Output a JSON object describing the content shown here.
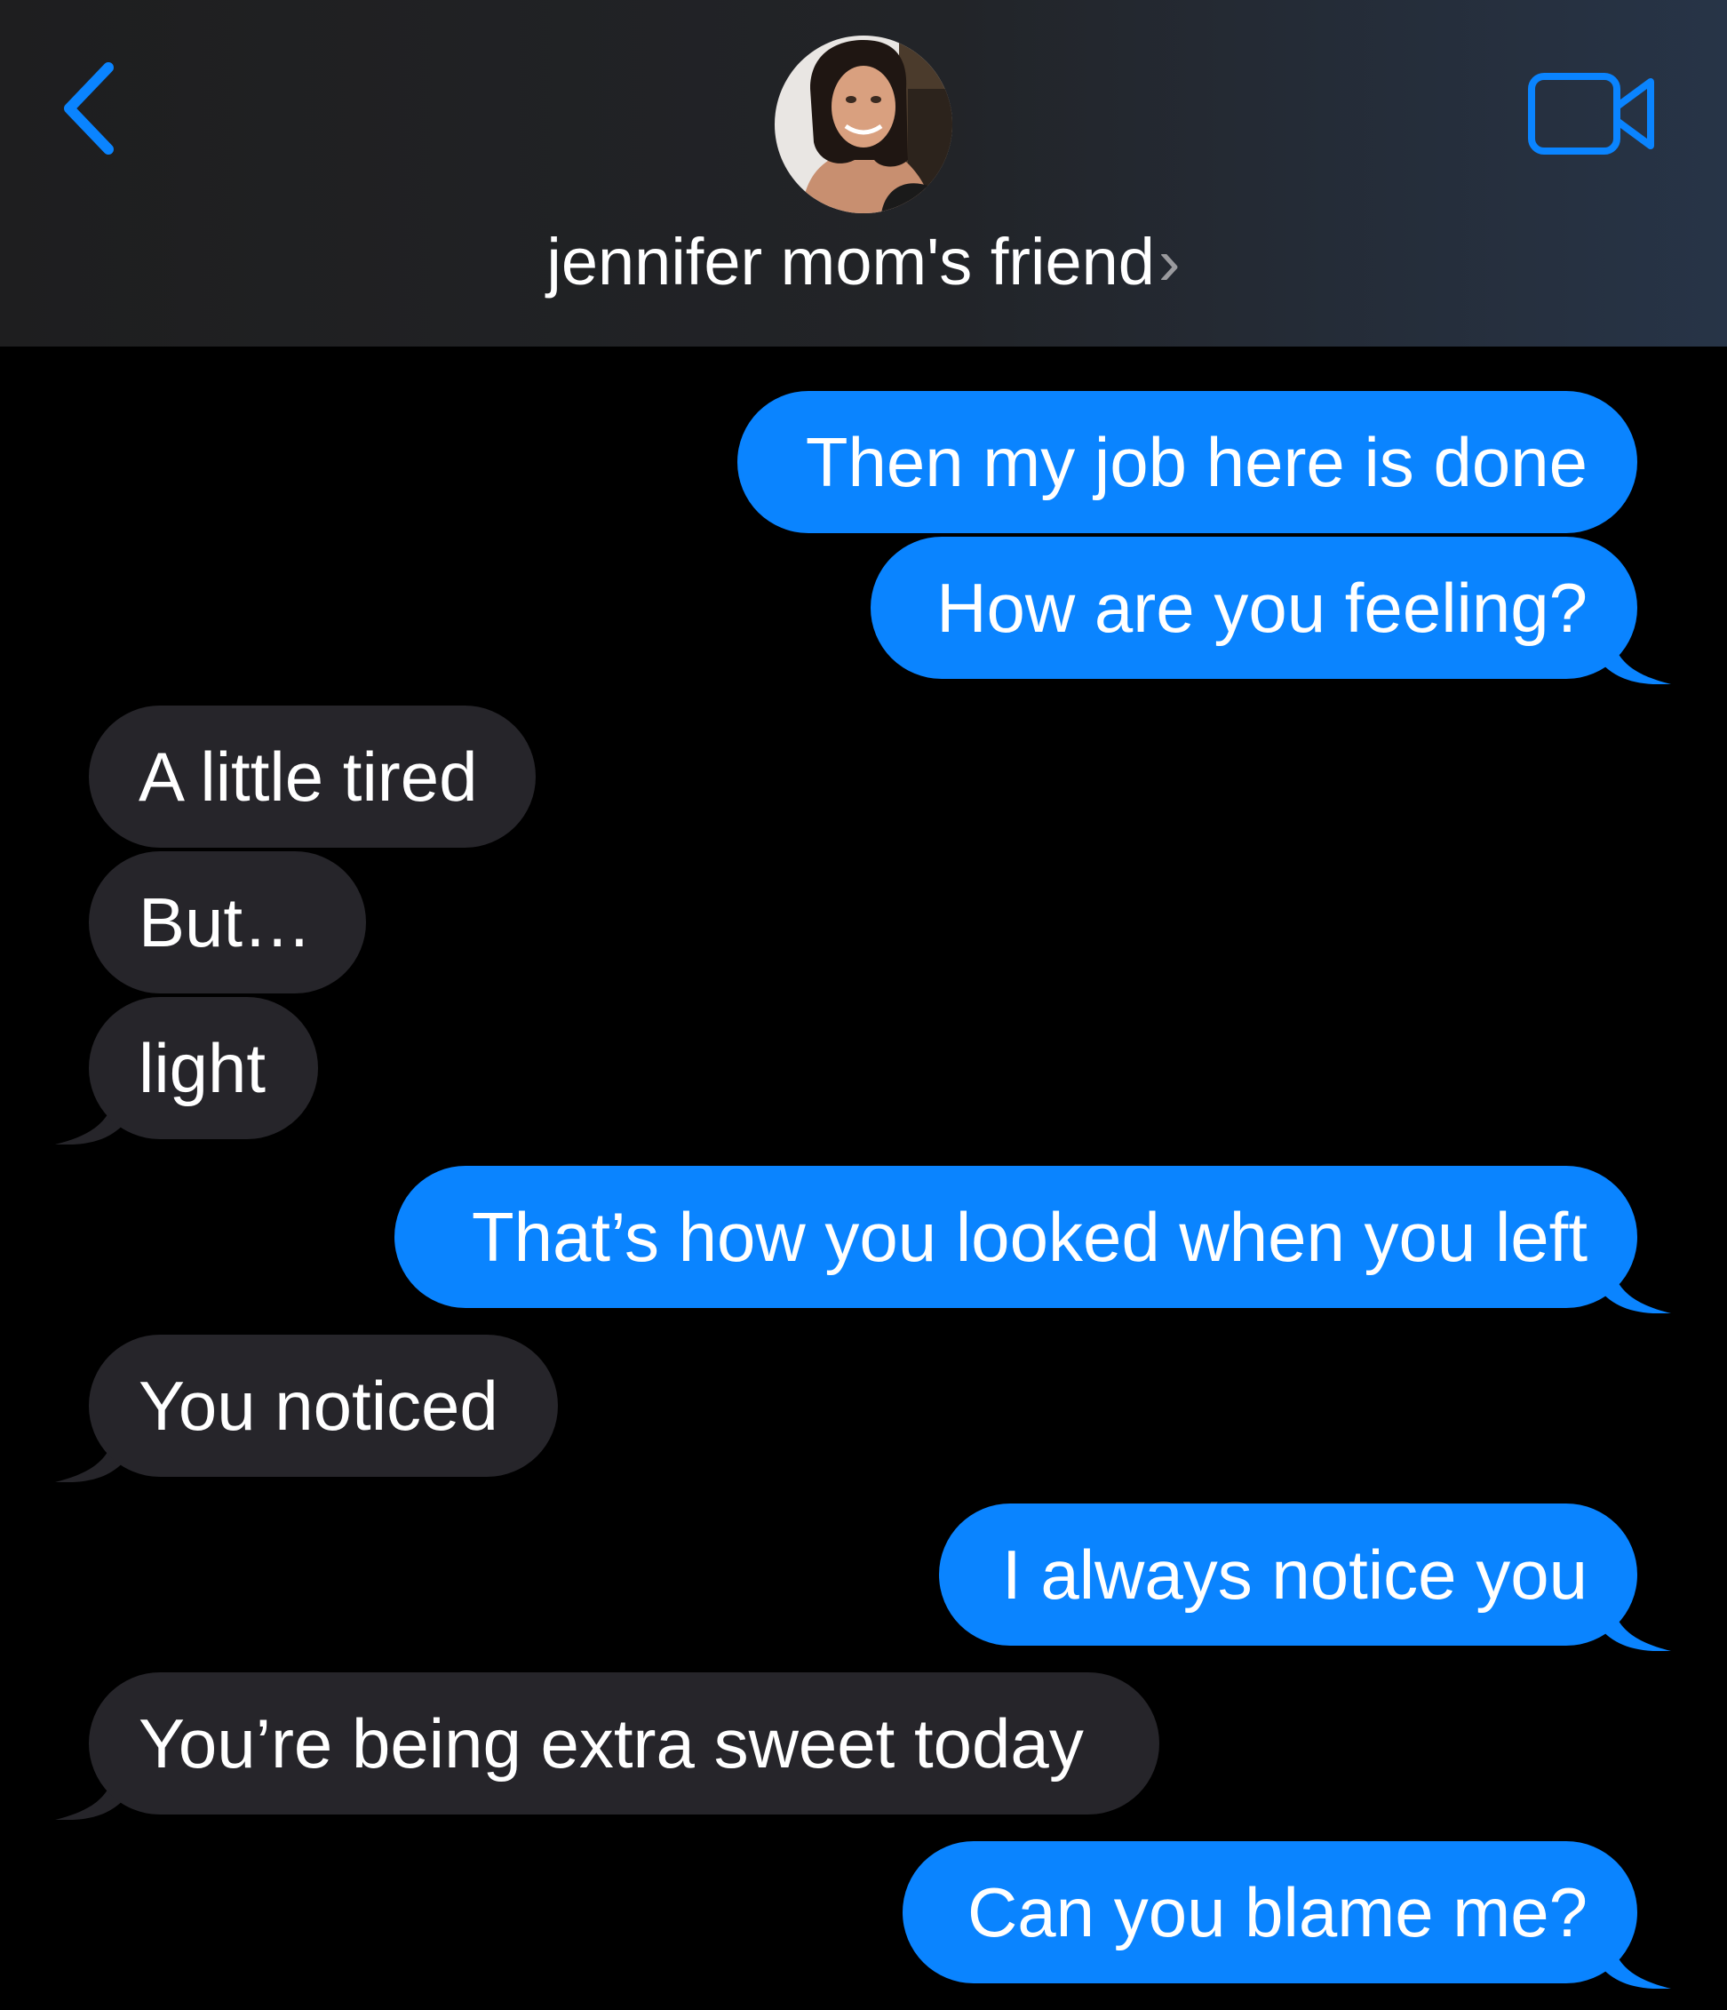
{
  "header": {
    "back_icon": "chevron-left-icon",
    "contact_name": "jennifer mom's friend",
    "contact_chevron": "›",
    "video_icon": "video-camera-icon",
    "accent_color": "#0a84ff"
  },
  "messages": [
    {
      "from": "me",
      "text": "Then my job here is done"
    },
    {
      "from": "me",
      "text": "How are you feeling?"
    },
    {
      "from": "them",
      "text": "A little tired"
    },
    {
      "from": "them",
      "text": "But…"
    },
    {
      "from": "them",
      "text": "light"
    },
    {
      "from": "me",
      "text": "That’s how you looked when you left"
    },
    {
      "from": "them",
      "text": "You noticed"
    },
    {
      "from": "me",
      "text": "I always notice you"
    },
    {
      "from": "them",
      "text": "You’re being extra sweet today"
    },
    {
      "from": "me",
      "text": "Can you blame me?"
    }
  ],
  "colors": {
    "sent_bubble": "#0a84ff",
    "received_bubble": "#26252a",
    "background": "#000000"
  }
}
